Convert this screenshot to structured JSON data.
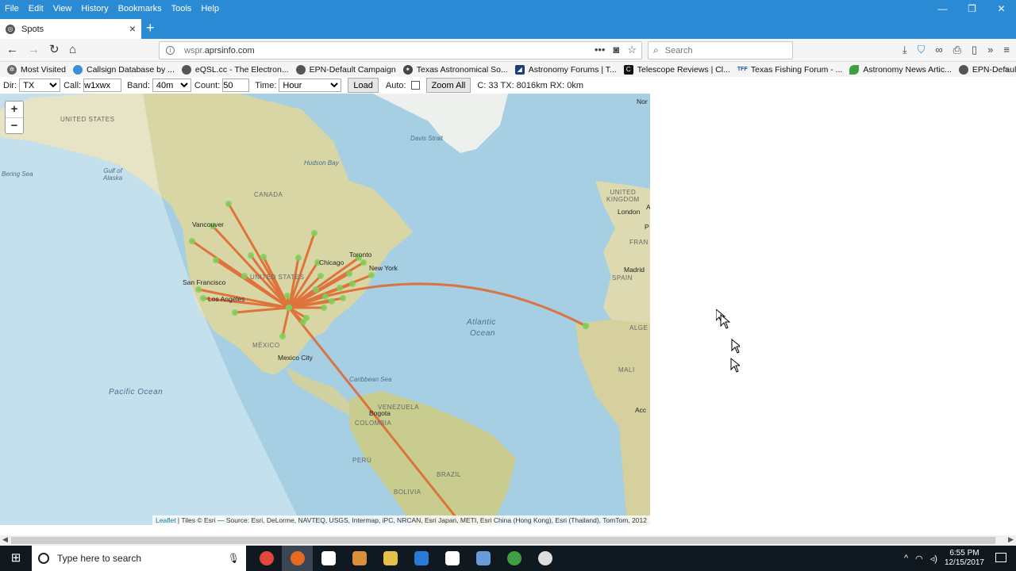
{
  "menubar": {
    "items": [
      "File",
      "Edit",
      "View",
      "History",
      "Bookmarks",
      "Tools",
      "Help"
    ],
    "window_controls": [
      "—",
      "❐",
      "✕"
    ]
  },
  "tab": {
    "title": "Spots",
    "close": "×",
    "new_tab": "+"
  },
  "navbar": {
    "url_prefix": "wspr.",
    "url_domain": "aprsinfo.com",
    "search_placeholder": "Search"
  },
  "bookmarks": [
    {
      "label": "Most Visited",
      "icon": "gear-icon",
      "color": "#666666"
    },
    {
      "label": "Callsign Database by ...",
      "icon": "globe-icon",
      "color": "#3a8fd8"
    },
    {
      "label": "eQSL.cc - The Electron...",
      "icon": "globe-icon",
      "color": "#555555"
    },
    {
      "label": "EPN-Default Campaign",
      "icon": "globe-icon",
      "color": "#555555"
    },
    {
      "label": "Texas Astronomical So...",
      "icon": "star-icon",
      "color": "#444444"
    },
    {
      "label": "Astronomy Forums | T...",
      "icon": "forum-icon",
      "color": "#1c3c7a"
    },
    {
      "label": "Telescope Reviews | Cl...",
      "icon": "c-icon",
      "color": "#111111"
    },
    {
      "label": "Texas Fishing Forum - ...",
      "icon": "tff-icon",
      "color": "#1a4aa8"
    },
    {
      "label": "Astronomy News Artic...",
      "icon": "leaf-icon",
      "color": "#3fa03f"
    },
    {
      "label": "EPN-Default Campaign",
      "icon": "globe-icon",
      "color": "#555555"
    }
  ],
  "controls": {
    "dir_label": "Dir:",
    "dir_value": "TX",
    "call_label": "Call:",
    "call_value": "w1xwx",
    "band_label": "Band:",
    "band_value": "40m",
    "count_label": "Count:",
    "count_value": "50",
    "time_label": "Time:",
    "time_value": "Hour",
    "load_button": "Load",
    "auto_label": "Auto:",
    "zoom_all_button": "Zoom All",
    "stats": "C: 33 TX: 8016km RX: 0km"
  },
  "map": {
    "zoom_in": "+",
    "zoom_out": "−",
    "attribution_link": "Leaflet",
    "attribution": " | Tiles © Esri — Source: Esri, DeLorme, NAVTEQ, USGS, Intermap, iPC, NRCAN, Esri Japan, METI, Esri China (Hong Kong), Esri (Thailand), TomTom, 2012",
    "labels": {
      "united_states_top": "UNITED STATES",
      "bering_sea": "Bering Sea",
      "gulf_of_alaska": "Gulf of\nAlaska",
      "canada": "CANADA",
      "hudson_bay": "Hudson Bay",
      "davis_strait": "Davis Strait",
      "vancouver": "Vancouver",
      "san_francisco": "San Francisco",
      "los_angeles": "Los Angeles",
      "united_states": "UNITED STATES",
      "chicago": "Chicago",
      "toronto": "Toronto",
      "new_york": "New York",
      "mexico": "MÉXICO",
      "mexico_city": "Mexico City",
      "pacific_ocean": "Pacific Ocean",
      "atlantic": "Atlantic",
      "ocean": "Ocean",
      "caribbean_sea": "Caribbean Sea",
      "venezuela": "VENEZUELA",
      "bogota": "Bogota",
      "colombia": "COLOMBIA",
      "peru": "PERÚ",
      "brazil": "BRAZIL",
      "bolivia": "BOLIVIA",
      "united_kingdom": "UNITED\nKINGDOM",
      "london": "London",
      "fran": "FRAN",
      "madrid": "Madrid",
      "spain": "SPAIN",
      "alge": "ALGE",
      "mali": "MALI",
      "accra": "Acc",
      "norway_cut": "Nor",
      "a_cut": "A",
      "p_cut": "P"
    }
  },
  "taskbar": {
    "search_text": "Type here to search",
    "time": "6:55 PM",
    "date": "12/15/2017",
    "apps": [
      {
        "name": "chrome-icon",
        "color": "#e04a3a"
      },
      {
        "name": "firefox-icon",
        "color": "#e86a1f"
      },
      {
        "name": "settings-icon",
        "color": "#ffffff"
      },
      {
        "name": "media-icon",
        "color": "#d9903a"
      },
      {
        "name": "folder-icon",
        "color": "#e7c04a"
      },
      {
        "name": "edge-icon",
        "color": "#2a7ad8"
      },
      {
        "name": "mail-icon",
        "color": "#ffffff"
      },
      {
        "name": "monitor-icon",
        "color": "#6a9ad8"
      },
      {
        "name": "globe-app-icon",
        "color": "#3fa03f"
      },
      {
        "name": "obs-icon",
        "color": "#dddddd"
      }
    ]
  },
  "colors": {
    "accent": "#2a8ad4",
    "path": "#e0642a",
    "station": "#7fd05a"
  }
}
